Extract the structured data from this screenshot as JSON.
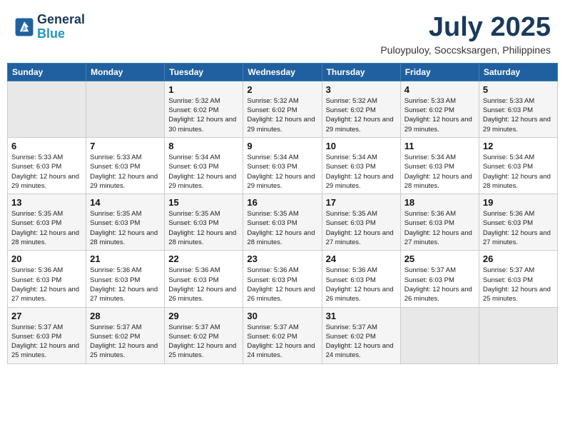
{
  "header": {
    "logo_line1": "General",
    "logo_line2": "Blue",
    "month": "July 2025",
    "location": "Puloypuloy, Soccsksargen, Philippines"
  },
  "weekdays": [
    "Sunday",
    "Monday",
    "Tuesday",
    "Wednesday",
    "Thursday",
    "Friday",
    "Saturday"
  ],
  "weeks": [
    [
      {
        "day": "",
        "sunrise": "",
        "sunset": "",
        "daylight": ""
      },
      {
        "day": "",
        "sunrise": "",
        "sunset": "",
        "daylight": ""
      },
      {
        "day": "1",
        "sunrise": "Sunrise: 5:32 AM",
        "sunset": "Sunset: 6:02 PM",
        "daylight": "Daylight: 12 hours and 30 minutes."
      },
      {
        "day": "2",
        "sunrise": "Sunrise: 5:32 AM",
        "sunset": "Sunset: 6:02 PM",
        "daylight": "Daylight: 12 hours and 29 minutes."
      },
      {
        "day": "3",
        "sunrise": "Sunrise: 5:32 AM",
        "sunset": "Sunset: 6:02 PM",
        "daylight": "Daylight: 12 hours and 29 minutes."
      },
      {
        "day": "4",
        "sunrise": "Sunrise: 5:33 AM",
        "sunset": "Sunset: 6:02 PM",
        "daylight": "Daylight: 12 hours and 29 minutes."
      },
      {
        "day": "5",
        "sunrise": "Sunrise: 5:33 AM",
        "sunset": "Sunset: 6:03 PM",
        "daylight": "Daylight: 12 hours and 29 minutes."
      }
    ],
    [
      {
        "day": "6",
        "sunrise": "Sunrise: 5:33 AM",
        "sunset": "Sunset: 6:03 PM",
        "daylight": "Daylight: 12 hours and 29 minutes."
      },
      {
        "day": "7",
        "sunrise": "Sunrise: 5:33 AM",
        "sunset": "Sunset: 6:03 PM",
        "daylight": "Daylight: 12 hours and 29 minutes."
      },
      {
        "day": "8",
        "sunrise": "Sunrise: 5:34 AM",
        "sunset": "Sunset: 6:03 PM",
        "daylight": "Daylight: 12 hours and 29 minutes."
      },
      {
        "day": "9",
        "sunrise": "Sunrise: 5:34 AM",
        "sunset": "Sunset: 6:03 PM",
        "daylight": "Daylight: 12 hours and 29 minutes."
      },
      {
        "day": "10",
        "sunrise": "Sunrise: 5:34 AM",
        "sunset": "Sunset: 6:03 PM",
        "daylight": "Daylight: 12 hours and 29 minutes."
      },
      {
        "day": "11",
        "sunrise": "Sunrise: 5:34 AM",
        "sunset": "Sunset: 6:03 PM",
        "daylight": "Daylight: 12 hours and 28 minutes."
      },
      {
        "day": "12",
        "sunrise": "Sunrise: 5:34 AM",
        "sunset": "Sunset: 6:03 PM",
        "daylight": "Daylight: 12 hours and 28 minutes."
      }
    ],
    [
      {
        "day": "13",
        "sunrise": "Sunrise: 5:35 AM",
        "sunset": "Sunset: 6:03 PM",
        "daylight": "Daylight: 12 hours and 28 minutes."
      },
      {
        "day": "14",
        "sunrise": "Sunrise: 5:35 AM",
        "sunset": "Sunset: 6:03 PM",
        "daylight": "Daylight: 12 hours and 28 minutes."
      },
      {
        "day": "15",
        "sunrise": "Sunrise: 5:35 AM",
        "sunset": "Sunset: 6:03 PM",
        "daylight": "Daylight: 12 hours and 28 minutes."
      },
      {
        "day": "16",
        "sunrise": "Sunrise: 5:35 AM",
        "sunset": "Sunset: 6:03 PM",
        "daylight": "Daylight: 12 hours and 28 minutes."
      },
      {
        "day": "17",
        "sunrise": "Sunrise: 5:35 AM",
        "sunset": "Sunset: 6:03 PM",
        "daylight": "Daylight: 12 hours and 27 minutes."
      },
      {
        "day": "18",
        "sunrise": "Sunrise: 5:36 AM",
        "sunset": "Sunset: 6:03 PM",
        "daylight": "Daylight: 12 hours and 27 minutes."
      },
      {
        "day": "19",
        "sunrise": "Sunrise: 5:36 AM",
        "sunset": "Sunset: 6:03 PM",
        "daylight": "Daylight: 12 hours and 27 minutes."
      }
    ],
    [
      {
        "day": "20",
        "sunrise": "Sunrise: 5:36 AM",
        "sunset": "Sunset: 6:03 PM",
        "daylight": "Daylight: 12 hours and 27 minutes."
      },
      {
        "day": "21",
        "sunrise": "Sunrise: 5:36 AM",
        "sunset": "Sunset: 6:03 PM",
        "daylight": "Daylight: 12 hours and 27 minutes."
      },
      {
        "day": "22",
        "sunrise": "Sunrise: 5:36 AM",
        "sunset": "Sunset: 6:03 PM",
        "daylight": "Daylight: 12 hours and 26 minutes."
      },
      {
        "day": "23",
        "sunrise": "Sunrise: 5:36 AM",
        "sunset": "Sunset: 6:03 PM",
        "daylight": "Daylight: 12 hours and 26 minutes."
      },
      {
        "day": "24",
        "sunrise": "Sunrise: 5:36 AM",
        "sunset": "Sunset: 6:03 PM",
        "daylight": "Daylight: 12 hours and 26 minutes."
      },
      {
        "day": "25",
        "sunrise": "Sunrise: 5:37 AM",
        "sunset": "Sunset: 6:03 PM",
        "daylight": "Daylight: 12 hours and 26 minutes."
      },
      {
        "day": "26",
        "sunrise": "Sunrise: 5:37 AM",
        "sunset": "Sunset: 6:03 PM",
        "daylight": "Daylight: 12 hours and 25 minutes."
      }
    ],
    [
      {
        "day": "27",
        "sunrise": "Sunrise: 5:37 AM",
        "sunset": "Sunset: 6:03 PM",
        "daylight": "Daylight: 12 hours and 25 minutes."
      },
      {
        "day": "28",
        "sunrise": "Sunrise: 5:37 AM",
        "sunset": "Sunset: 6:02 PM",
        "daylight": "Daylight: 12 hours and 25 minutes."
      },
      {
        "day": "29",
        "sunrise": "Sunrise: 5:37 AM",
        "sunset": "Sunset: 6:02 PM",
        "daylight": "Daylight: 12 hours and 25 minutes."
      },
      {
        "day": "30",
        "sunrise": "Sunrise: 5:37 AM",
        "sunset": "Sunset: 6:02 PM",
        "daylight": "Daylight: 12 hours and 24 minutes."
      },
      {
        "day": "31",
        "sunrise": "Sunrise: 5:37 AM",
        "sunset": "Sunset: 6:02 PM",
        "daylight": "Daylight: 12 hours and 24 minutes."
      },
      {
        "day": "",
        "sunrise": "",
        "sunset": "",
        "daylight": ""
      },
      {
        "day": "",
        "sunrise": "",
        "sunset": "",
        "daylight": ""
      }
    ]
  ]
}
